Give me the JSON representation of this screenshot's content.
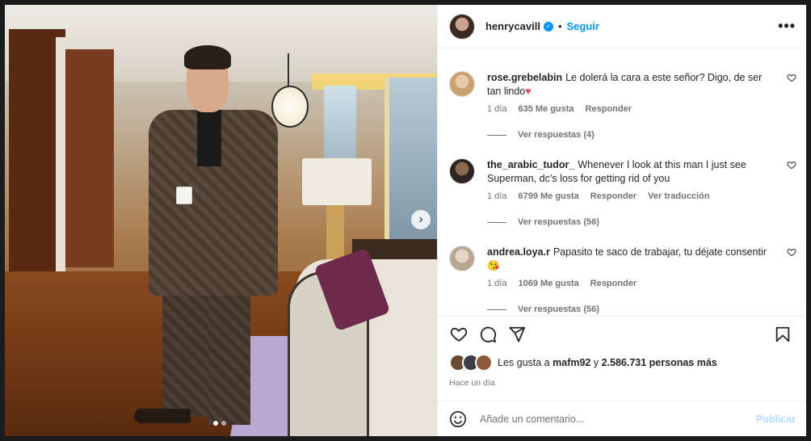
{
  "post": {
    "username": "henrycavill",
    "separator": "•",
    "follow_label": "Seguir",
    "more_label": "•••"
  },
  "comments": [
    {
      "user": "rose.grebelabin",
      "text": "Le dolerá la cara a este señor? Digo, de ser tan lindo",
      "emoji": "♥",
      "time": "1 día",
      "likes": "635 Me gusta",
      "reply": "Responder",
      "translate": "",
      "view_replies": "Ver respuestas (4)"
    },
    {
      "user": "the_arabic_tudor_",
      "text": "Whenever I look at this man I just see Superman, dc’s loss for getting rid of you",
      "emoji": "",
      "time": "1 día",
      "likes": "6799 Me gusta",
      "reply": "Responder",
      "translate": "Ver traducción",
      "view_replies": "Ver respuestas (56)"
    },
    {
      "user": "andrea.loya.r",
      "text": "Papasito te saco de trabajar, tu déjate consentir",
      "emoji": "😘",
      "time": "1 día",
      "likes": "1069 Me gusta",
      "reply": "Responder",
      "translate": "",
      "view_replies": "Ver respuestas (56)"
    }
  ],
  "likes_line": {
    "prefix": "Les gusta a",
    "user": "mafm92",
    "middle": "y",
    "count": "2.586.731 personas más"
  },
  "posted_time": "Hace un día",
  "add_comment": {
    "placeholder": "Añade un comentario...",
    "publish_label": "Publicar"
  },
  "carousel": {
    "next_arrow": "›",
    "dots": 2,
    "active_dot": 0
  },
  "colors": {
    "accent": "#0095f6",
    "publish_disabled": "#b3dbff",
    "heart_red": "#ed4956"
  }
}
